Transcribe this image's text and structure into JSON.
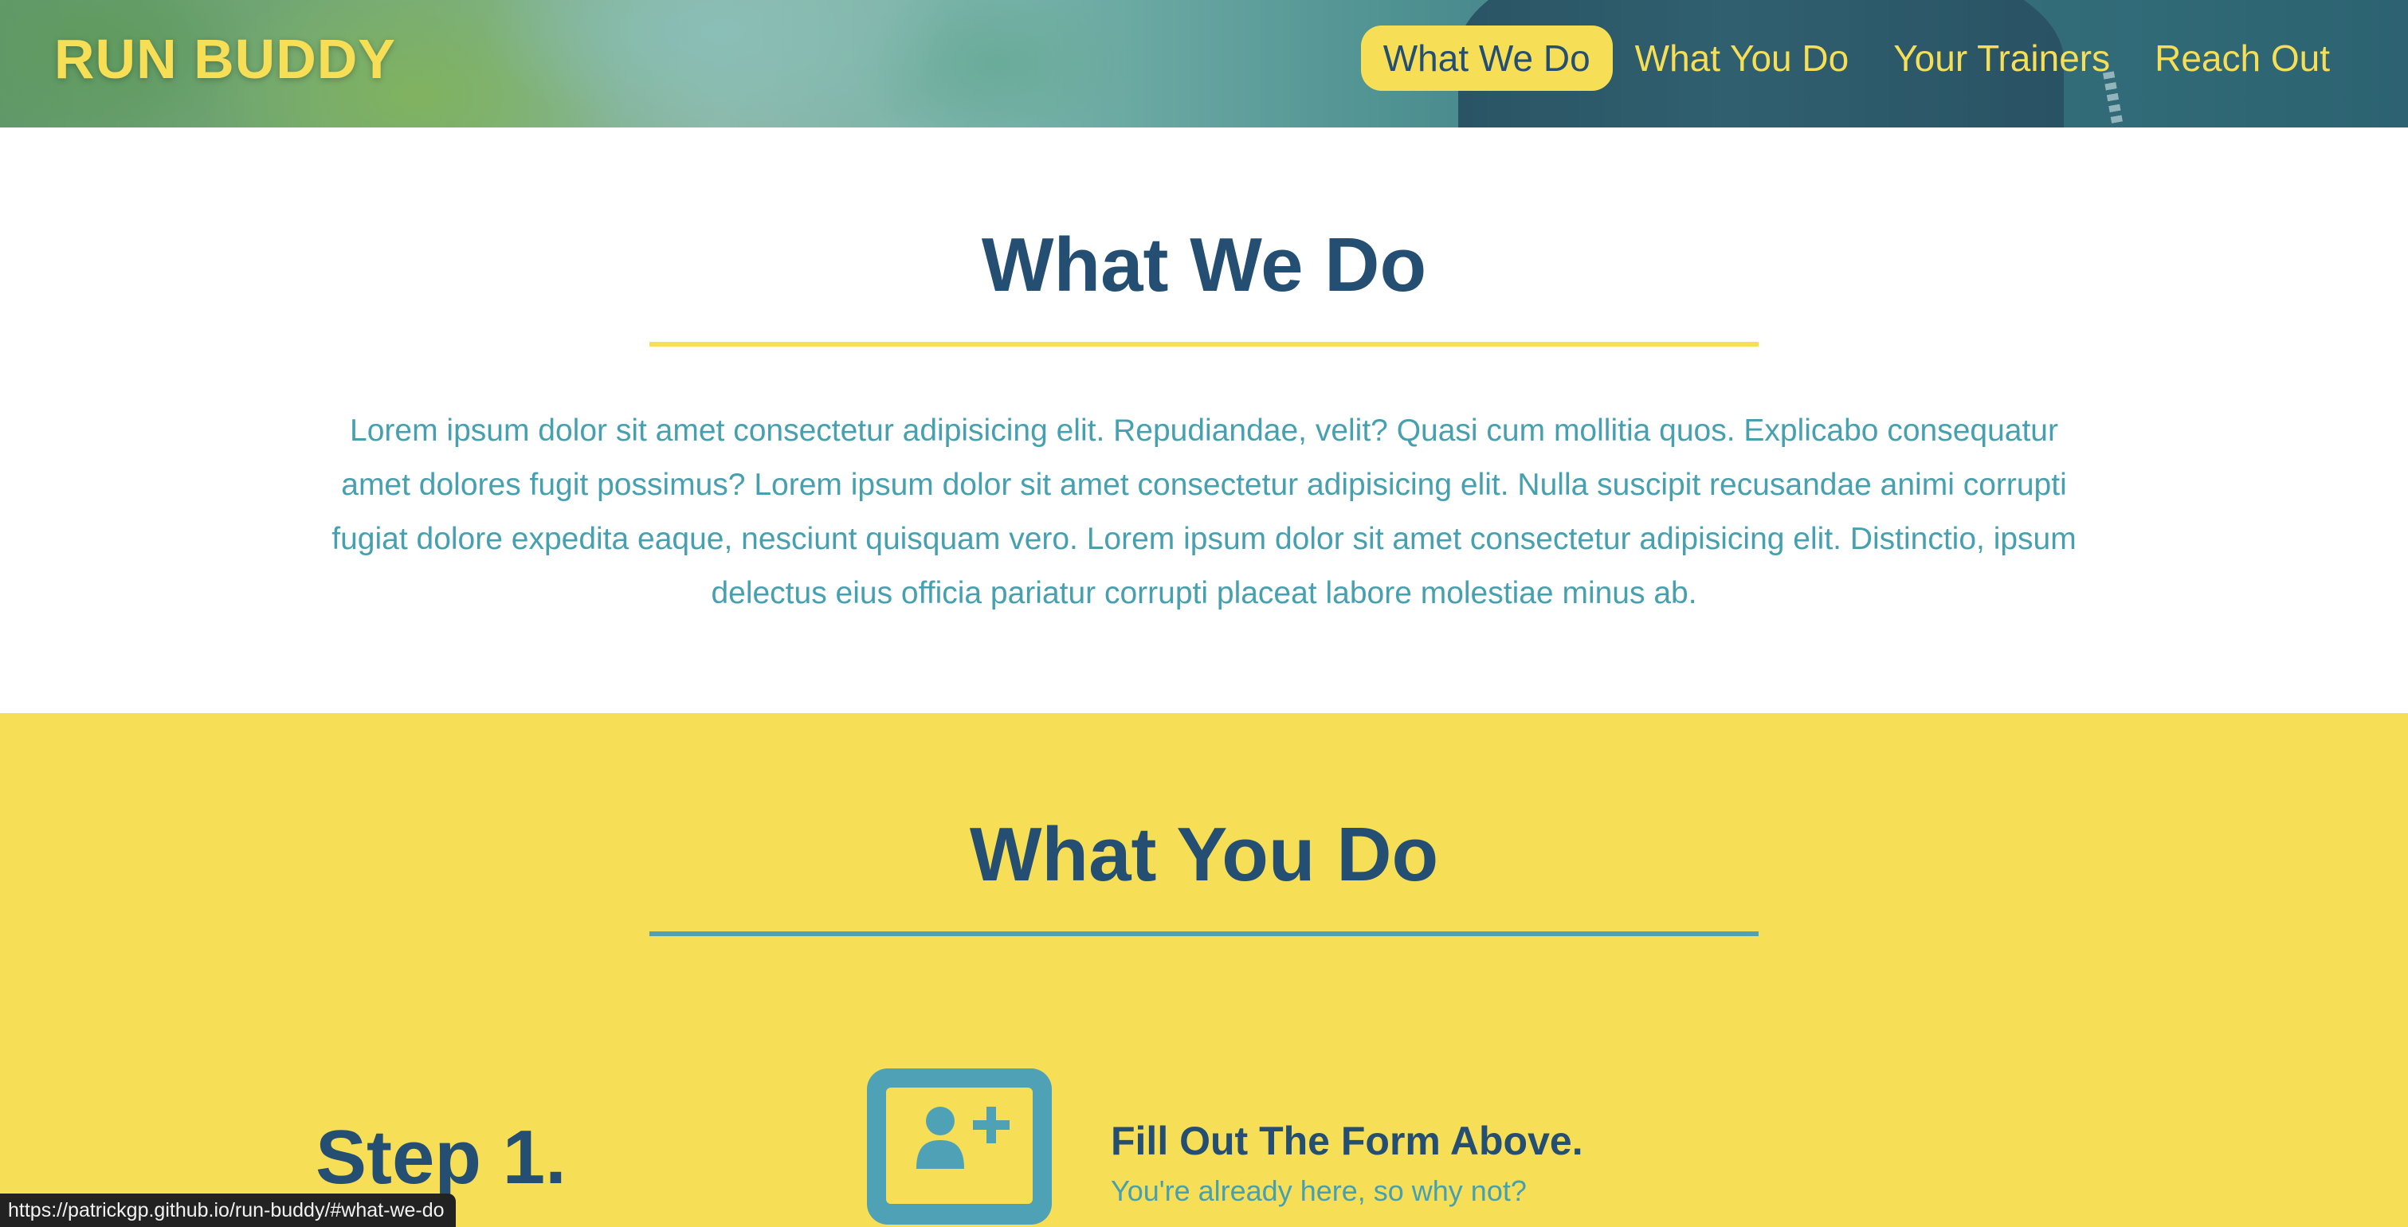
{
  "header": {
    "brand": "RUN BUDDY",
    "nav": [
      {
        "label": "What We Do",
        "active": true
      },
      {
        "label": "What You Do",
        "active": false
      },
      {
        "label": "Your Trainers",
        "active": false
      },
      {
        "label": "Reach Out",
        "active": false
      }
    ]
  },
  "what_we_do": {
    "title": "What We Do",
    "body": "Lorem ipsum dolor sit amet consectetur adipisicing elit. Repudiandae, velit? Quasi cum mollitia quos. Explicabo consequatur amet dolores fugit possimus? Lorem ipsum dolor sit amet consectetur adipisicing elit. Nulla suscipit recusandae animi corrupti fugiat dolore expedita eaque, nesciunt quisquam vero. Lorem ipsum dolor sit amet consectetur adipisicing elit. Distinctio, ipsum delectus eius officia pariatur corrupti placeat labore molestiae minus ab."
  },
  "what_you_do": {
    "title": "What You Do",
    "steps": [
      {
        "label": "Step 1.",
        "icon": "add-user-screen-icon",
        "heading": "Fill Out The Form Above.",
        "subtext": "You're already here, so why not?"
      }
    ]
  },
  "status_bar": {
    "url": "https://patrickgp.github.io/run-buddy/#what-we-do"
  },
  "colors": {
    "brand_yellow": "#f6df57",
    "navy": "#244e72",
    "teal": "#46a0b0"
  }
}
